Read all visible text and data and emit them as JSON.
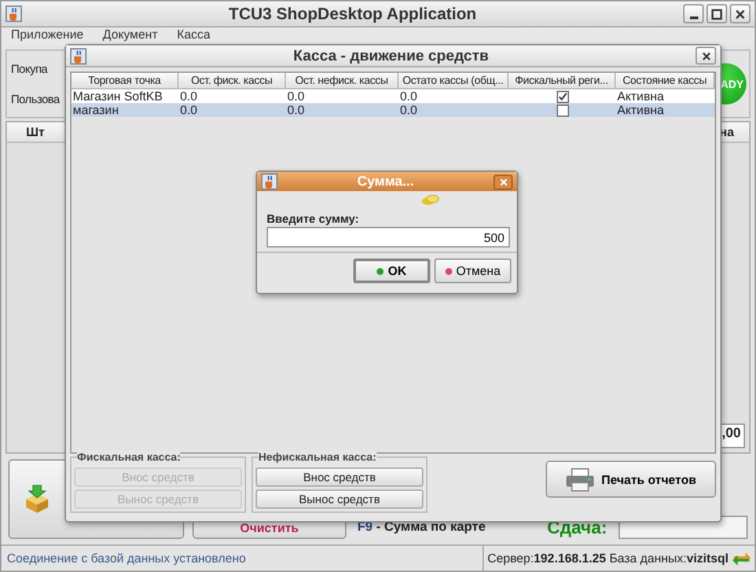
{
  "window": {
    "title": "TCU3 ShopDesktop Application"
  },
  "menu": [
    "Приложение",
    "Документ",
    "Касса"
  ],
  "main": {
    "labels": [
      "Покупа",
      "Пользова"
    ],
    "ready_badge": "ADY",
    "table_columns": [
      "Шт",
      "на"
    ],
    "total": ",00",
    "clear_button": "Очистить",
    "hotkey": {
      "key": "F9",
      "label": "- Сумма по карте"
    },
    "change_label": "Сдача:"
  },
  "status_bar": {
    "message": "Соединение с базой данных установлено",
    "server_label": "Сервер:",
    "server": "192.168.1.25",
    "db_label": "База данных:",
    "db": "vizitsql"
  },
  "cash_dialog": {
    "title": "Касса - движение средств",
    "columns": [
      "Торговая точка",
      "Ост. фиск. кассы",
      "Ост. нефиск. кассы",
      "Остато кассы (общ...",
      "Фискальный реги...",
      "Состояние кассы"
    ],
    "rows": [
      {
        "point": "Магазин SoftKB",
        "fiscal_rest": "0.0",
        "nonfiscal_rest": "0.0",
        "total_rest": "0.0",
        "fiscal": true,
        "state": "Активна",
        "selected": false
      },
      {
        "point": "магазин",
        "fiscal_rest": "0.0",
        "nonfiscal_rest": "0.0",
        "total_rest": "0.0",
        "fiscal": false,
        "state": "Активна",
        "selected": true
      }
    ],
    "groups": [
      {
        "title": "Фискальная касса:",
        "disabled": true,
        "buttons": [
          "Внос средств",
          "Вынос средств"
        ]
      },
      {
        "title": "Нефискальная касса:",
        "disabled": false,
        "buttons": [
          "Внос средств",
          "Вынос средств"
        ]
      }
    ],
    "print_button": "Печать отчетов"
  },
  "amount_dialog": {
    "title": "Сумма...",
    "prompt": "Введите сумму:",
    "value": "500",
    "buttons": [
      {
        "label": "OK",
        "color": "#22a02a",
        "default": true
      },
      {
        "label": "Отмена",
        "color": "#e0407a",
        "default": false
      }
    ]
  }
}
